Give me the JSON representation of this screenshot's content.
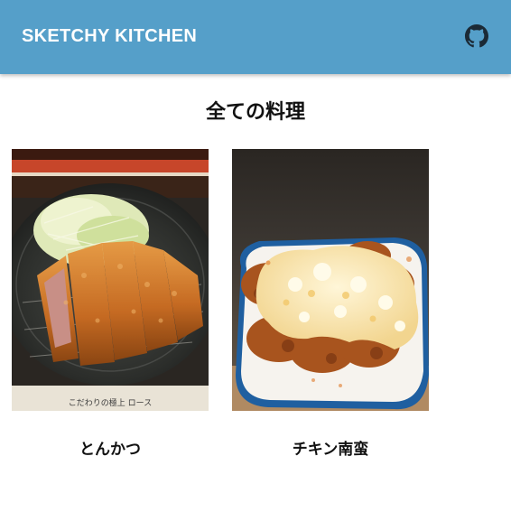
{
  "header": {
    "brand": "SKETCHY KITCHEN",
    "github_icon": "github-icon",
    "background": "#559fc9"
  },
  "main": {
    "title": "全ての料理",
    "recipes": [
      {
        "name": "とんかつ",
        "image": "tonkatsu-photo"
      },
      {
        "name": "チキン南蛮",
        "image": "chicken-nanban-photo"
      }
    ],
    "photo_caption_text": "こだわりの極上 ロース"
  }
}
